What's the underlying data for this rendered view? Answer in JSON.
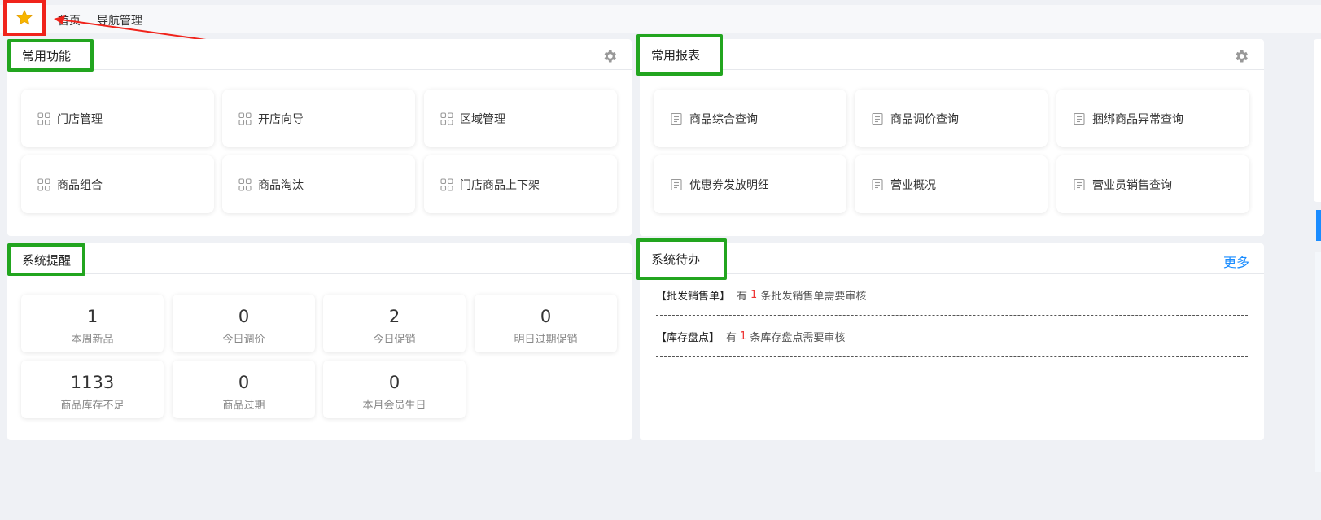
{
  "topbar": {
    "home_label": "首页",
    "manage_label": "导航管理"
  },
  "common_functions": {
    "title": "常用功能",
    "items": [
      "门店管理",
      "开店向导",
      "区域管理",
      "商品组合",
      "商品淘汰",
      "门店商品上下架"
    ]
  },
  "common_reports": {
    "title": "常用报表",
    "items": [
      "商品综合查询",
      "商品调价查询",
      "捆绑商品异常查询",
      "优惠券发放明细",
      "营业概况",
      "营业员销售查询"
    ]
  },
  "system_reminders": {
    "title": "系统提醒",
    "stats": [
      {
        "value": "1",
        "label": "本周新品"
      },
      {
        "value": "0",
        "label": "今日调价"
      },
      {
        "value": "2",
        "label": "今日促销"
      },
      {
        "value": "0",
        "label": "明日过期促销"
      },
      {
        "value": "1133",
        "label": "商品库存不足"
      },
      {
        "value": "0",
        "label": "商品过期"
      },
      {
        "value": "0",
        "label": "本月会员生日"
      }
    ]
  },
  "system_todo": {
    "title": "系统待办",
    "more_label": "更多",
    "items": [
      {
        "tag": "【批发销售单】",
        "prefix": "有",
        "count": "1",
        "suffix": "条批发销售单需要审核"
      },
      {
        "tag": "【库存盘点】",
        "prefix": "有",
        "count": "1",
        "suffix": "条库存盘点需要审核"
      }
    ]
  },
  "colors": {
    "highlight_red": "#f0231b",
    "highlight_green": "#22a51f",
    "link_blue": "#1a8cff",
    "star_yellow": "#f7b500"
  }
}
